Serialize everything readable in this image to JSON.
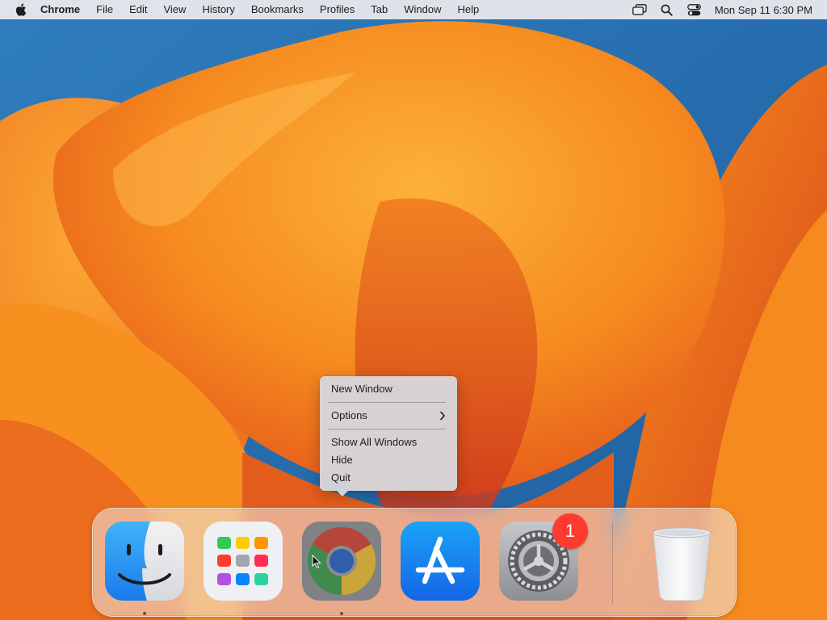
{
  "menubar": {
    "apple_icon": "apple-logo-icon",
    "app_name": "Chrome",
    "items": [
      "File",
      "Edit",
      "View",
      "History",
      "Bookmarks",
      "Profiles",
      "Tab",
      "Window",
      "Help"
    ],
    "status_icons": [
      "screen-mirroring-icon",
      "search-icon",
      "control-center-icon"
    ],
    "clock": "Mon Sep 11  6:30 PM"
  },
  "context_menu": {
    "items": [
      {
        "label": "New Window"
      },
      {
        "label": "Options",
        "has_submenu": true
      },
      {
        "label": "Show All Windows"
      },
      {
        "label": "Hide"
      },
      {
        "label": "Quit"
      }
    ]
  },
  "dock": {
    "apps": [
      {
        "icon": "finder-icon",
        "running": true
      },
      {
        "icon": "launchpad-icon",
        "running": false
      },
      {
        "icon": "chrome-icon",
        "running": true
      },
      {
        "icon": "app-store-icon",
        "running": false
      },
      {
        "icon": "system-settings-icon",
        "running": false,
        "badge": "1"
      },
      {
        "icon": "trash-icon",
        "running": false
      }
    ]
  },
  "colors": {
    "wallpaper_blue": "#2a6fae",
    "wallpaper_orange": "#f7921e",
    "wallpaper_deep": "#e0521a",
    "badge_red": "#ff3b30"
  }
}
